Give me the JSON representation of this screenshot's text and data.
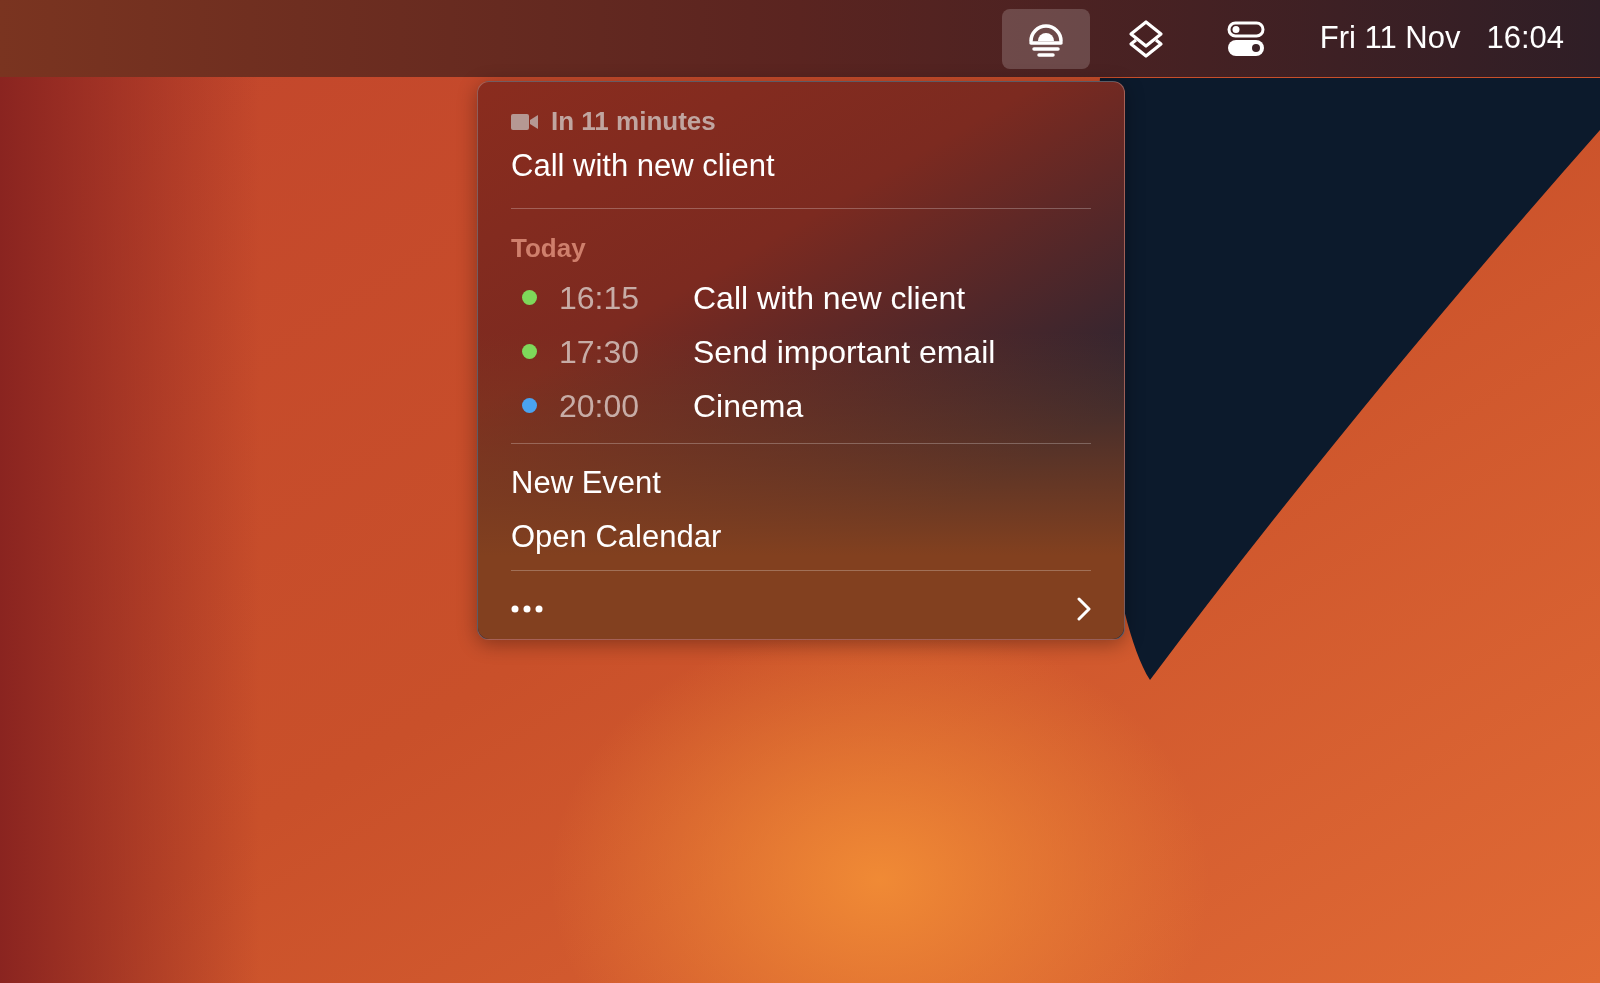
{
  "menu_bar": {
    "items": [
      {
        "kind": "sunrise",
        "selected": true
      },
      {
        "kind": "layers",
        "selected": false
      },
      {
        "kind": "toggles",
        "selected": false
      }
    ],
    "date": "Fri 11 Nov",
    "time": "16:04"
  },
  "popup": {
    "next_event": {
      "countdown": "In 11 minutes",
      "title": "Call with new client"
    },
    "section_title": "Today",
    "events": [
      {
        "time": "16:15",
        "title": "Call with new client",
        "color": "#7ed85a"
      },
      {
        "time": "17:30",
        "title": "Send important email",
        "color": "#7ed85a"
      },
      {
        "time": "20:00",
        "title": "Cinema",
        "color": "#4aa3f0"
      }
    ],
    "actions": [
      "New Event",
      "Open Calendar"
    ]
  }
}
